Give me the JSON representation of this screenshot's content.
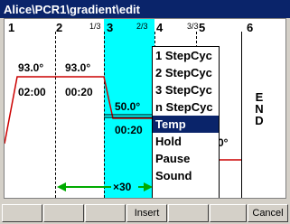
{
  "window": {
    "title": "Alice\\PCR1\\gradient\\edit"
  },
  "steps": [
    {
      "num": "1",
      "temp": "93.0°",
      "time": "02:00"
    },
    {
      "num": "2",
      "temp": "93.0°",
      "time": "00:20",
      "fraction": "1/3"
    },
    {
      "num": "3",
      "temp": "50.0°",
      "time": "00:20",
      "fraction": "2/3"
    },
    {
      "num": "4",
      "fraction": "3/3",
      "partial_temp": "0°"
    },
    {
      "num": "5"
    },
    {
      "num": "6",
      "end_label": [
        "E",
        "N",
        "D"
      ]
    }
  ],
  "loop": {
    "label": "×30"
  },
  "context_menu": {
    "items": [
      "1 StepCyc",
      "2 StepCyc",
      "3 StepCyc",
      "n StepCyc",
      "Temp",
      "Hold",
      "Pause",
      "Sound"
    ],
    "selected": "Temp"
  },
  "buttons": [
    "",
    "",
    "",
    "Insert",
    "",
    "",
    "Cancel"
  ],
  "colors": {
    "title_bg": "#0a246a",
    "highlight": "#00ffff",
    "ramp_line": "#cc0000",
    "loop_arrow": "#00aa00"
  }
}
